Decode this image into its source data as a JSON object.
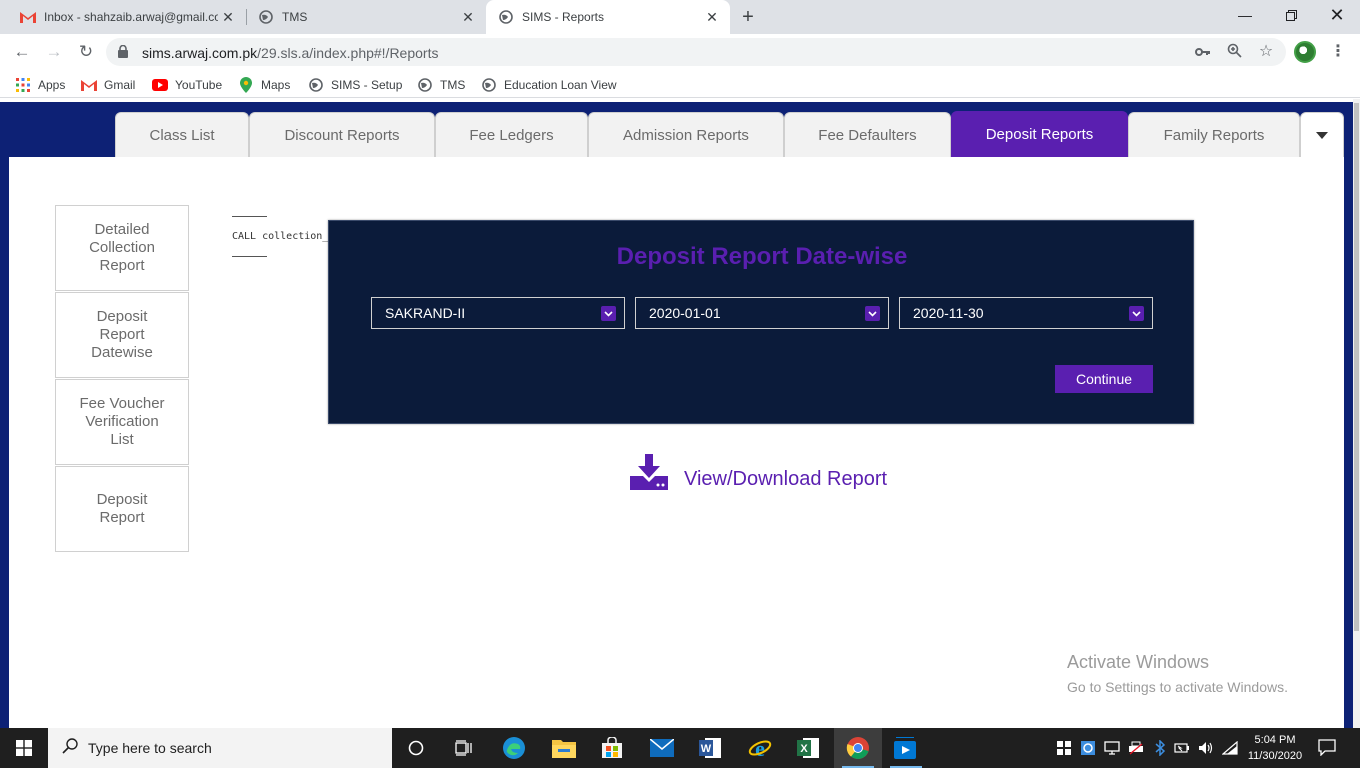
{
  "browser": {
    "tabs": [
      {
        "title": "Inbox - shahzaib.arwaj@gmail.co",
        "icon": "gmail-icon",
        "active": false
      },
      {
        "title": "TMS",
        "icon": "globe-icon",
        "active": false
      },
      {
        "title": "SIMS - Reports",
        "icon": "globe-icon",
        "active": true
      }
    ],
    "url_host": "sims.arwaj.com.pk",
    "url_path": "/29.sls.a/index.php#!/Reports",
    "bookmarks": [
      {
        "label": "Apps",
        "icon": "apps-grid-icon"
      },
      {
        "label": "Gmail",
        "icon": "gmail-icon"
      },
      {
        "label": "YouTube",
        "icon": "youtube-icon"
      },
      {
        "label": "Maps",
        "icon": "maps-pin-icon"
      },
      {
        "label": "SIMS - Setup",
        "icon": "globe-icon"
      },
      {
        "label": "TMS",
        "icon": "globe-icon"
      },
      {
        "label": "Education Loan View",
        "icon": "globe-icon"
      }
    ]
  },
  "report_tabs": [
    {
      "label": "Class List",
      "active": false
    },
    {
      "label": "Discount Reports",
      "active": false
    },
    {
      "label": "Fee Ledgers",
      "active": false
    },
    {
      "label": "Admission Reports",
      "active": false
    },
    {
      "label": "Fee Defaulters",
      "active": false
    },
    {
      "label": "Deposit Reports",
      "active": true
    },
    {
      "label": "Family Reports",
      "active": false
    }
  ],
  "sidebar": [
    {
      "label": "Detailed Collection Report"
    },
    {
      "label": "Deposit Report Datewise"
    },
    {
      "label": "Fee Voucher Verification List"
    },
    {
      "label": "Deposit Report"
    }
  ],
  "debug_text": "CALL collection_",
  "dialog": {
    "title": "Deposit Report Date-wise",
    "campus": "SAKRAND-II",
    "date_from": "2020-01-01",
    "date_to": "2020-11-30",
    "continue_label": "Continue"
  },
  "download_label": "View/Download Report",
  "watermark": {
    "line1": "Activate Windows",
    "line2": "Go to Settings to activate Windows."
  },
  "taskbar": {
    "search_placeholder": "Type here to search",
    "time": "5:04 PM",
    "date": "11/30/2020"
  },
  "colors": {
    "accent": "#5a1fb0",
    "nav_band": "#0d2175",
    "dialog_bg": "#0b1b3a"
  }
}
